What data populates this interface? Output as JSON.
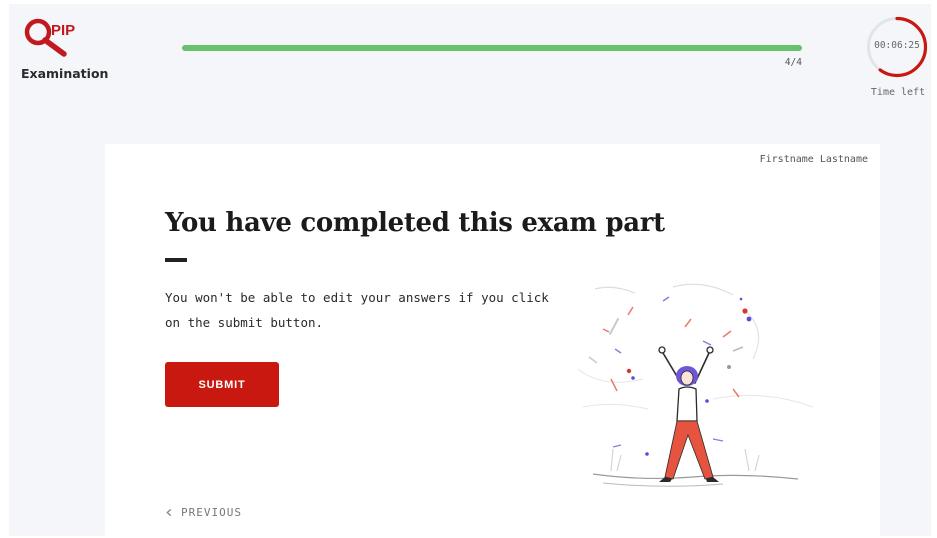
{
  "app": {
    "logo_text": "PIP",
    "title": "Examination"
  },
  "progress": {
    "current": 4,
    "total": 4,
    "fraction": 1.0,
    "label": "4/4"
  },
  "timer": {
    "value": "00:06:25",
    "label": "Time left",
    "remaining_fraction": 0.6
  },
  "user": {
    "name": "Firstname Lastname"
  },
  "content": {
    "heading": "You have completed this exam part",
    "description": "You won't be able to edit your answers if you click on the submit button.",
    "submit_label": "SUBMIT",
    "previous_label": "PREVIOUS"
  },
  "colors": {
    "brand_red": "#c8180f",
    "progress_green": "#6cc26c",
    "background": "#f5f6fa",
    "card": "#ffffff"
  }
}
